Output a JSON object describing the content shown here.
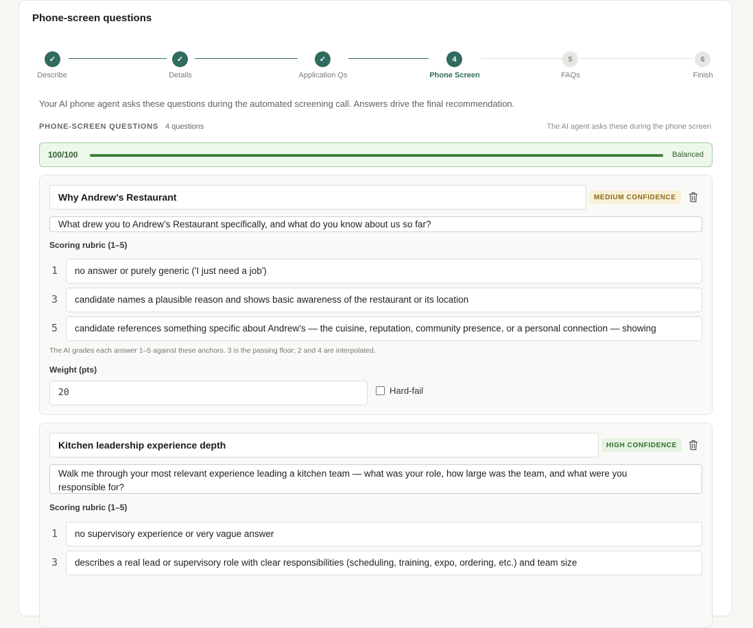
{
  "card": {
    "title": "Phone-screen questions"
  },
  "stepper": {
    "steps": [
      {
        "label": "Describe",
        "state": "done",
        "num": "1"
      },
      {
        "label": "Details",
        "state": "done",
        "num": "2"
      },
      {
        "label": "Application Qs",
        "state": "done",
        "num": "3"
      },
      {
        "label": "Phone Screen",
        "state": "current",
        "num": "4"
      },
      {
        "label": "FAQs",
        "state": "pending",
        "num": "5"
      },
      {
        "label": "Finish",
        "state": "pending",
        "num": "6"
      }
    ],
    "check": "✓"
  },
  "intro": "Your AI phone agent asks these questions during the automated screening call. Answers drive the final recommendation.",
  "section": {
    "heading": "PHONE-SCREEN QUESTIONS",
    "count": "4 questions",
    "right_note": "The AI agent asks these during the phone screen"
  },
  "weightbar": {
    "score": "100/100",
    "fill_percent": 100,
    "status": "Balanced"
  },
  "questions": [
    {
      "title": "Why Andrew’s Restaurant",
      "confidence": "MEDIUM CONFIDENCE",
      "prompt": "What drew you to Andrew’s Restaurant specifically, and what do you know about us so far?",
      "rubric_label": "Scoring rubric (1–5)",
      "rubric": [
        {
          "score": "1",
          "text": "no answer or purely generic ('I just need a job')"
        },
        {
          "score": "3",
          "text": "candidate names a plausible reason and shows basic awareness of the restaurant or its location"
        },
        {
          "score": "5",
          "text": "candidate references something specific about Andrew’s — the cuisine, reputation, community presence, or a personal connection — showing"
        }
      ],
      "hint": "The AI grades each answer 1–5 against these anchors. 3 is the passing floor; 2 and 4 are interpolated.",
      "weight_label": "Weight (pts)",
      "weight": "20",
      "hard_fail_label": "Hard-fail"
    },
    {
      "title": "Kitchen leadership experience depth",
      "confidence": "HIGH CONFIDENCE",
      "prompt_line1": "Walk me through your most relevant experience leading a kitchen team — what was your role, how large was the team, and what were you",
      "prompt_line2": "responsible for?",
      "rubric_label": "Scoring rubric (1–5)",
      "rubric": [
        {
          "score": "1",
          "text": "no supervisory experience or very vague answer"
        },
        {
          "score": "3",
          "text": "describes a real lead or supervisory role with clear responsibilities (scheduling, training, expo, ordering, etc.) and team size"
        }
      ]
    }
  ]
}
